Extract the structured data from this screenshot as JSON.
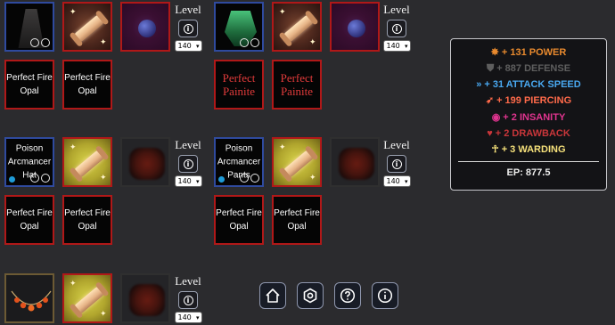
{
  "level_label": "Level",
  "level_value": "140",
  "info_glyph": "i",
  "gems": {
    "fire_opal": "Perfect Fire Opal",
    "painite": "Perfect Painite"
  },
  "items": {
    "hat": "Poison Arcmancer Hat",
    "pants": "Poison Arcmancer Pants"
  },
  "stats": {
    "power": "+ 131 POWER",
    "defense": "+ 887 DEFENSE",
    "attack_speed": "+ 31 ATTACK SPEED",
    "piercing": "+ 199 PIERCING",
    "insanity": "+ 2 INSANITY",
    "drawback": "+ 2 DRAWBACK",
    "warding": "+ 3 WARDING",
    "ep": "EP: 877.5"
  },
  "colors": {
    "power": "#e98a2e",
    "defense": "#6b6b6b",
    "attack_speed": "#49a8f0",
    "piercing": "#ff6a4a",
    "insanity": "#e0348f",
    "drawback": "#c9363a",
    "warding": "#f5e07a",
    "slot_border_red": "#b01818"
  },
  "nav": {
    "home": "home-icon",
    "settings": "settings-icon",
    "help": "help-icon",
    "info": "info-icon"
  }
}
